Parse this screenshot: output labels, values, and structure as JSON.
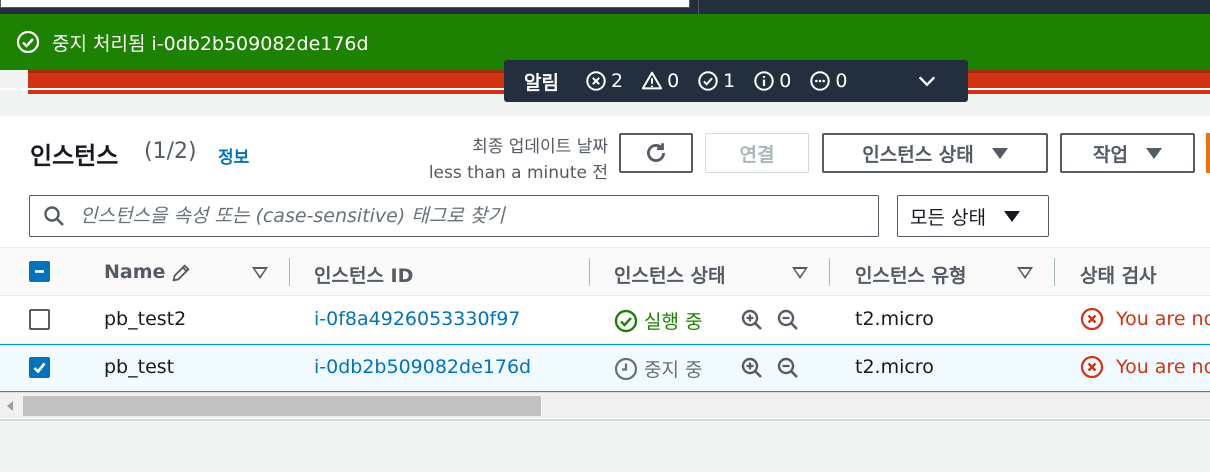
{
  "flash": {
    "message": "중지 처리됨 i-0db2b509082de176d"
  },
  "notifications": {
    "title": "알림",
    "counts": [
      {
        "icon": "error-circle-icon",
        "value": "2"
      },
      {
        "icon": "warning-triangle-icon",
        "value": "0"
      },
      {
        "icon": "success-circle-icon",
        "value": "1"
      },
      {
        "icon": "info-circle-icon",
        "value": "0"
      },
      {
        "icon": "in-progress-circle-icon",
        "value": "0"
      }
    ]
  },
  "header": {
    "title": "인스턴스",
    "count": "(1/2)",
    "info_link": "정보",
    "last_updated_label": "최종 업데이트 날짜",
    "last_updated_value": "less than a minute 전"
  },
  "toolbar": {
    "connect_label": "연결",
    "instance_state_label": "인스턴스 상태",
    "actions_label": "작업",
    "accent_color": "#ec7211"
  },
  "filter": {
    "placeholder": "인스턴스을 속성 또는 (case-sensitive) 태그로 찾기",
    "state_select": "모든 상태"
  },
  "table": {
    "columns": [
      "Name",
      "인스턴스 ID",
      "인스턴스 상태",
      "인스턴스 유형",
      "상태 검사"
    ],
    "rows": [
      {
        "selected": false,
        "name": "pb_test2",
        "instance_id": "i-0f8a4926053330f97",
        "state": "실행 중",
        "state_color": "#1d8102",
        "type": "t2.micro",
        "status_check": "You are no"
      },
      {
        "selected": true,
        "name": "pb_test",
        "instance_id": "i-0db2b509082de176d",
        "state": "중지 중",
        "state_color": "#687078",
        "type": "t2.micro",
        "status_check": "You are no"
      }
    ]
  },
  "colors": {
    "success": "#1d8102",
    "error": "#d13212",
    "link": "#0073bb",
    "header_dark": "#232f3e"
  }
}
